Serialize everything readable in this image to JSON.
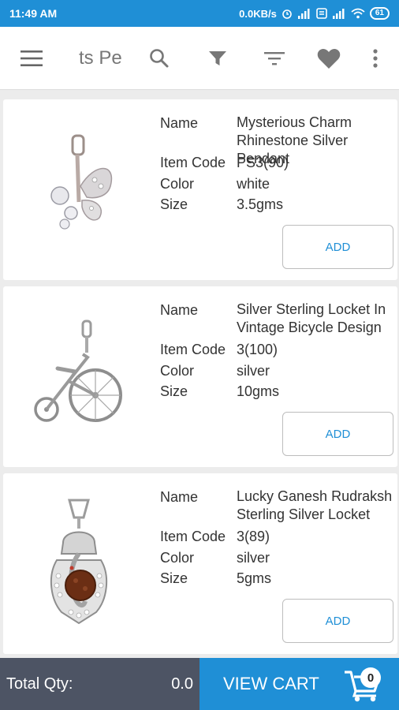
{
  "status_bar": {
    "time": "11:49 AM",
    "net_speed": "0.0KB/s",
    "battery": "61"
  },
  "toolbar": {
    "title": "ts Pe",
    "icons": [
      "menu-icon",
      "search-icon",
      "filter-icon",
      "sort-icon",
      "heart-icon",
      "more-vert-icon"
    ]
  },
  "labels": {
    "name": "Name",
    "item_code": "Item Code",
    "color": "Color",
    "size": "Size",
    "add": "ADD"
  },
  "products": [
    {
      "name": "Mysterious Charm Rhinestone Silver Pendant",
      "item_code": "PS3(90)",
      "color": "white",
      "size": "3.5gms"
    },
    {
      "name": "Silver Sterling Locket In Vintage Bicycle Design",
      "item_code": "3(100)",
      "color": "silver",
      "size": "10gms"
    },
    {
      "name": "Lucky Ganesh Rudraksh Sterling Silver Locket",
      "item_code": "3(89)",
      "color": "silver",
      "size": "5gms"
    }
  ],
  "bottom_bar": {
    "total_qty_label": "Total Qty:",
    "total_qty_value": "0.0",
    "view_cart_label": "VIEW CART",
    "cart_count": "0"
  },
  "colors": {
    "primary": "#1f8fd6",
    "bottom_dark": "#4d5464",
    "background": "#ececec"
  }
}
